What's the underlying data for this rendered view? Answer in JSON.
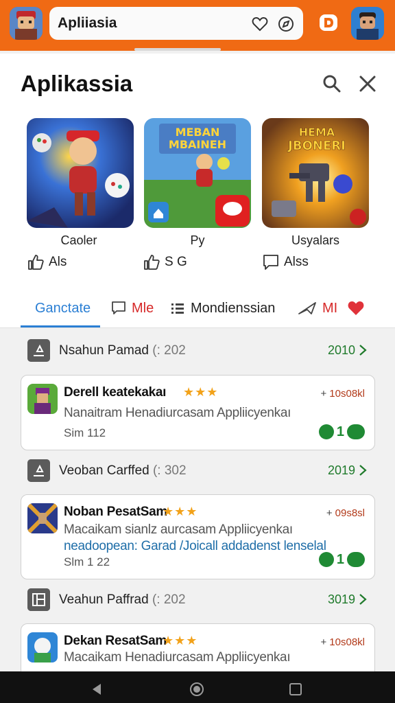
{
  "search": {
    "text": "Apliiasia"
  },
  "header": {
    "title": "Aplikassia"
  },
  "games": [
    {
      "name": "Caoler",
      "meta": "Als"
    },
    {
      "name": "Py",
      "meta": "S G",
      "art_text": [
        "MEBAN",
        "MBAINEH"
      ]
    },
    {
      "name": "Usyalars",
      "meta": "Alss",
      "art_text": [
        "HEMA",
        "JBONERI"
      ]
    }
  ],
  "tabs": [
    {
      "label": "Ganctate"
    },
    {
      "label": "Mle"
    },
    {
      "label": "Mondienssian"
    },
    {
      "label": "MI"
    }
  ],
  "sections": [
    {
      "title": "Nsahun Pamad",
      "suffix": "(: 202",
      "count": "2010"
    },
    {
      "title": "Veoban Carffed",
      "suffix": "(: 302",
      "count": "2019"
    },
    {
      "title": "Veahun Paffrad",
      "suffix": "(: 202",
      "count": "3019"
    }
  ],
  "apps": [
    {
      "name": "Derell keatekakaı",
      "stars": "★★★",
      "size": "10s08kl",
      "desc": "Nanaitram Henadiurcasam Appliicyenkaı",
      "version": "Sim 112",
      "badge": "1"
    },
    {
      "name": "Noban PesatSam",
      "stars": "★★★",
      "size": "09s8sl",
      "desc": "Macaikam sianlz aurcasam Appliicyenkaı",
      "desc2": "neadoopean: Garad /Joicall addadenst lenselal",
      "version": "Slm 1 22",
      "badge": "1"
    },
    {
      "name": "Dekan ResatSam",
      "stars": "★★★",
      "size": "10s08kl",
      "desc": "Macaikam Henadiurcasam Appliicyenkaı"
    }
  ],
  "colors": {
    "topbar": "#f06a14",
    "tab_active": "#2b7fd4",
    "tab_alt": "#d62828",
    "green": "#1f8a34",
    "star": "#f2a21a"
  },
  "icons": [
    "heart-icon",
    "compass-icon",
    "logo-d-icon",
    "search-icon",
    "close-icon",
    "thumbs-up-icon",
    "chat-icon",
    "list-icon",
    "share-icon",
    "chevron-right-icon",
    "back-icon",
    "home-icon",
    "recents-icon"
  ]
}
